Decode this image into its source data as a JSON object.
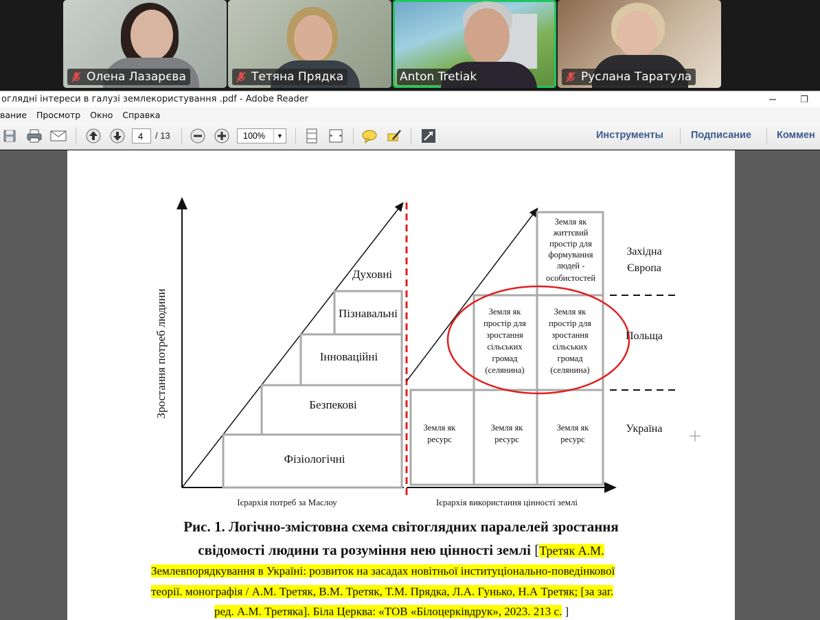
{
  "participants": [
    {
      "name": "Олена Лазарєва",
      "muted": true
    },
    {
      "name": "Тетяна Прядка",
      "muted": true
    },
    {
      "name": "Anton Tretiak",
      "muted": false,
      "active": true
    },
    {
      "name": "Руслана Таратула",
      "muted": true
    }
  ],
  "window": {
    "title": "оглядні інтереси в галузі землекористування .pdf - Adobe Reader",
    "restore_glyph": "❐"
  },
  "menu": [
    "вание",
    "Просмотр",
    "Окно",
    "Справка"
  ],
  "toolbar": {
    "page_current": "4",
    "page_total": "/ 13",
    "zoom": "100%",
    "tools_label": "Инструменты",
    "sign_label": "Подписание",
    "comment_label": "Коммен"
  },
  "figure": {
    "y_axis_label": "Зростання потреб людини",
    "left_x_label": "Ієрархія потреб за Маслоу",
    "right_x_label": "Ієрархія  використання цінності землі",
    "maslow": [
      "Фізіологічні",
      "Безпекові",
      "Інноваційні",
      "Пізнавальні",
      "Духовні"
    ],
    "cells": {
      "top": [
        "Земля як",
        "життєвий",
        "простір для",
        "формування",
        "людей -",
        "особистостей"
      ],
      "mid": [
        "Земля як",
        "простір для",
        "зростання",
        "сільських",
        "громад",
        "(селянина)"
      ],
      "bottom": [
        "Земля як",
        "ресурс"
      ]
    },
    "regions": {
      "west": [
        "Західна",
        "Європа"
      ],
      "poland": "Польща",
      "ukraine": "Україна"
    }
  },
  "caption": {
    "line1": "Рис. 1. Логічно-змістовна схема світоглядних паралелей зростання",
    "line2": "свідомості людини та розуміння нею цінності землі",
    "bracket_open": "[",
    "ref_part1": "Третяк А.М.",
    "ref_line2": "Землевпорядкування в Україні: розвиток на засадах новітньої інституціонально-поведінкової",
    "ref_line3a": "теорії. монографія / А.М. Третяк, В.М. Третяк, Т.М. Прядка, Л.А. Гунько, Н.А Третяк; [за заг.",
    "ref_line4": "ред. А.М. Третяка]. Біла Церква: «ТОВ «Білоцерківдрук», 2023. 213 с.",
    "bracket_close": "]"
  },
  "colors": {
    "active_border": "#22c55e",
    "highlight": "#ffff00",
    "link_blue": "#3a5a8c",
    "red_circle": "#e02020"
  }
}
